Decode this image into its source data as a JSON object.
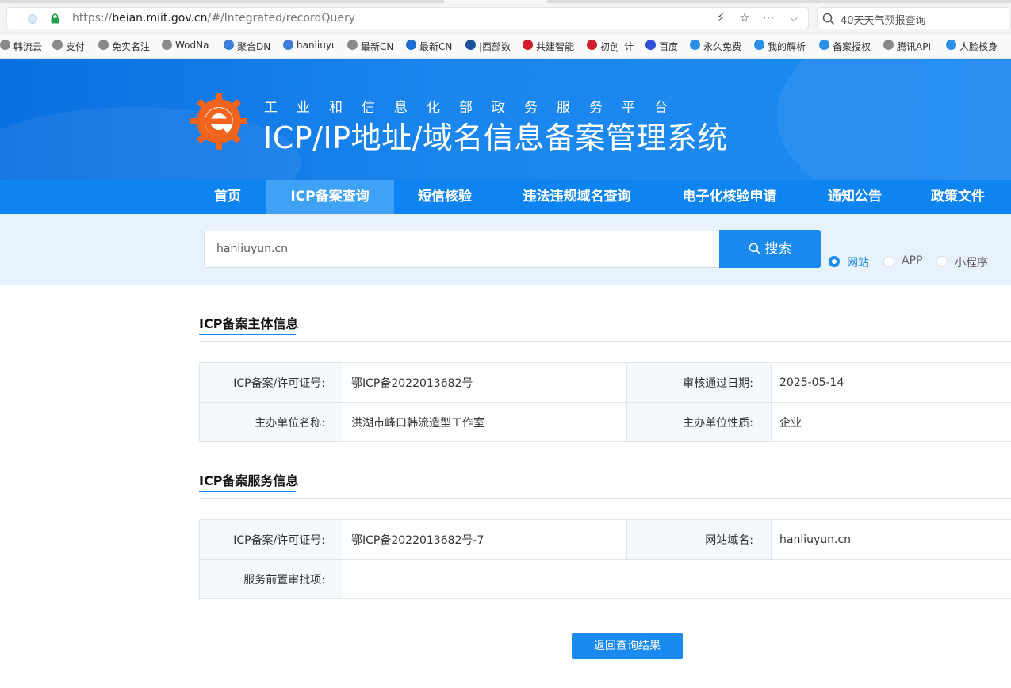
{
  "browser": {
    "url_prefix": "https://",
    "url_host": "beian.miit.gov.cn",
    "url_path": "/#/Integrated/recordQuery",
    "search_text": "40天天气预报查询",
    "bookmarks": [
      {
        "label": "韩流云",
        "color": "#8a8a8a"
      },
      {
        "label": "支付",
        "color": "#8a8a8a"
      },
      {
        "label": "免实名注",
        "color": "#8a8a8a"
      },
      {
        "label": "WodNa",
        "color": "#8a8a8a"
      },
      {
        "label": "聚合DN",
        "color": "#3f7fd8"
      },
      {
        "label": "hanliuyu",
        "color": "#3f7fd8"
      },
      {
        "label": "最新CN",
        "color": "#8a8a8a"
      },
      {
        "label": "最新CN",
        "color": "#1f6fd0"
      },
      {
        "label": "|西部数",
        "color": "#1c4f9c"
      },
      {
        "label": "共建智能",
        "color": "#cf1f2e"
      },
      {
        "label": "初创_计",
        "color": "#cf1f2e"
      },
      {
        "label": "百度",
        "color": "#2f4ed8"
      },
      {
        "label": "永久免费",
        "color": "#2b8fe6"
      },
      {
        "label": "我的解析",
        "color": "#2b8fe6"
      },
      {
        "label": "备案授权",
        "color": "#2b8fe6"
      },
      {
        "label": "腾讯API",
        "color": "#8a8a8a"
      },
      {
        "label": "人脸核身",
        "color": "#2b8fe6"
      }
    ]
  },
  "header": {
    "subtitle": "工业和信息化部政务服务平台",
    "title": "ICP/IP地址/域名信息备案管理系统"
  },
  "nav": [
    {
      "label": "首页"
    },
    {
      "label": "ICP备案查询"
    },
    {
      "label": "短信核验"
    },
    {
      "label": "违法违规域名查询"
    },
    {
      "label": "电子化核验申请"
    },
    {
      "label": "通知公告"
    },
    {
      "label": "政策文件"
    }
  ],
  "search": {
    "value": "hanliuyun.cn",
    "button_label": "搜索",
    "types": [
      {
        "label": "网站",
        "selected": true
      },
      {
        "label": "APP",
        "selected": false
      },
      {
        "label": "小程序",
        "selected": false
      }
    ]
  },
  "subject_info": {
    "title": "ICP备案主体信息",
    "license_label": "ICP备案/许可证号:",
    "license_value": "鄂ICP备2022013682号",
    "date_label": "审核通过日期:",
    "date_value": "2025-05-14",
    "org_label": "主办单位名称:",
    "org_value": "洪湖市峰口韩流造型工作室",
    "nature_label": "主办单位性质:",
    "nature_value": "企业"
  },
  "service_info": {
    "title": "ICP备案服务信息",
    "license_label": "ICP备案/许可证号:",
    "license_value": "鄂ICP备2022013682号-7",
    "domain_label": "网站域名:",
    "domain_value": "hanliuyun.cn",
    "approval_label": "服务前置审批项:",
    "approval_value": ""
  },
  "back_button": "返回查询结果",
  "colors": {
    "primary": "#1a8af0",
    "nav_active": "#3fa2f6",
    "logo_orange": "#f0641e"
  }
}
